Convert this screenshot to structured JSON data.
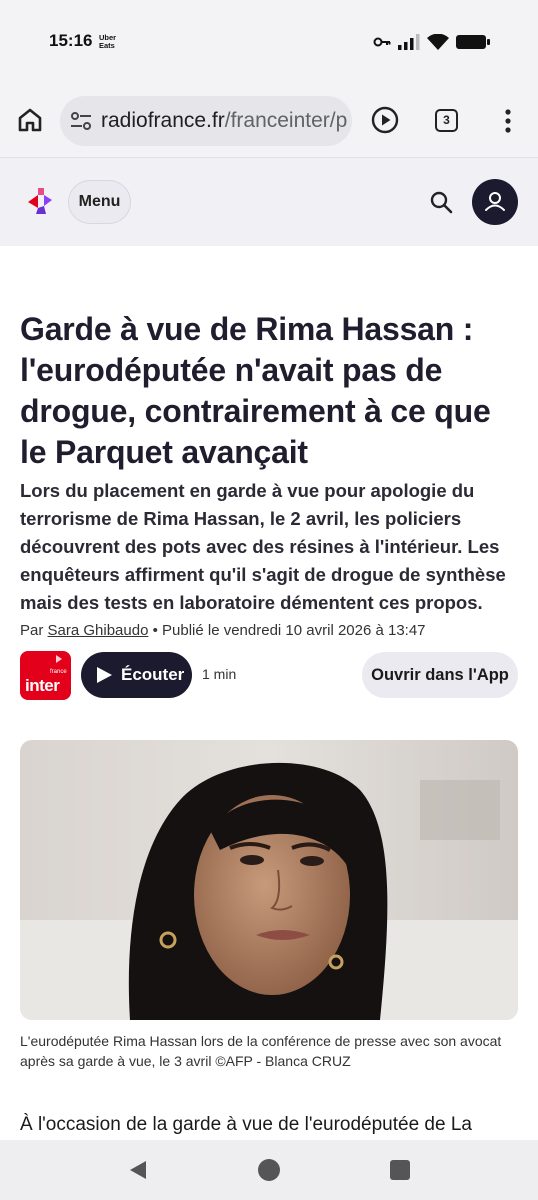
{
  "status_bar": {
    "time": "15:16",
    "notification_app": "Uber Eats",
    "icons": [
      "key-icon",
      "signal-icon",
      "wifi-icon",
      "battery-icon"
    ]
  },
  "browser": {
    "url_host": "radiofrance.fr",
    "url_path": "/franceinter/p",
    "tab_count": "3"
  },
  "site_header": {
    "menu_label": "Menu"
  },
  "article": {
    "headline": "Garde à vue de Rima Hassan : l'eurodéputée n'avait pas de drogue, contrairement à ce que le Parquet avançait",
    "chapo": "Lors du placement en garde à vue pour apologie du terrorisme de Rima Hassan, le 2 avril, les policiers découvrent des pots avec des résines à l'intérieur. Les enquêteurs affirment qu'il s'agit de drogue de synthèse mais des tests en laboratoire démentent ces propos.",
    "byline_prefix": "Par ",
    "author": "Sara Ghibaudo",
    "published": " • Publié le vendredi 10 avril 2026 à 13:47",
    "station_name": "inter",
    "station_small": "france",
    "listen_label": "Écouter",
    "duration": "1 min",
    "open_app_label": "Ouvrir dans l'App",
    "photo_caption": "L'eurodéputée Rima Hassan lors de la conférence de presse avec son avocat après sa garde à vue, le 3 avril ©AFP - Blanca CRUZ",
    "body_start": "À l'occasion de la garde à vue de l'eurodéputée de La"
  },
  "colors": {
    "brand_dark": "#1b1a2e",
    "france_inter_red": "#e2001a",
    "header_bg": "#f1f0f5"
  }
}
